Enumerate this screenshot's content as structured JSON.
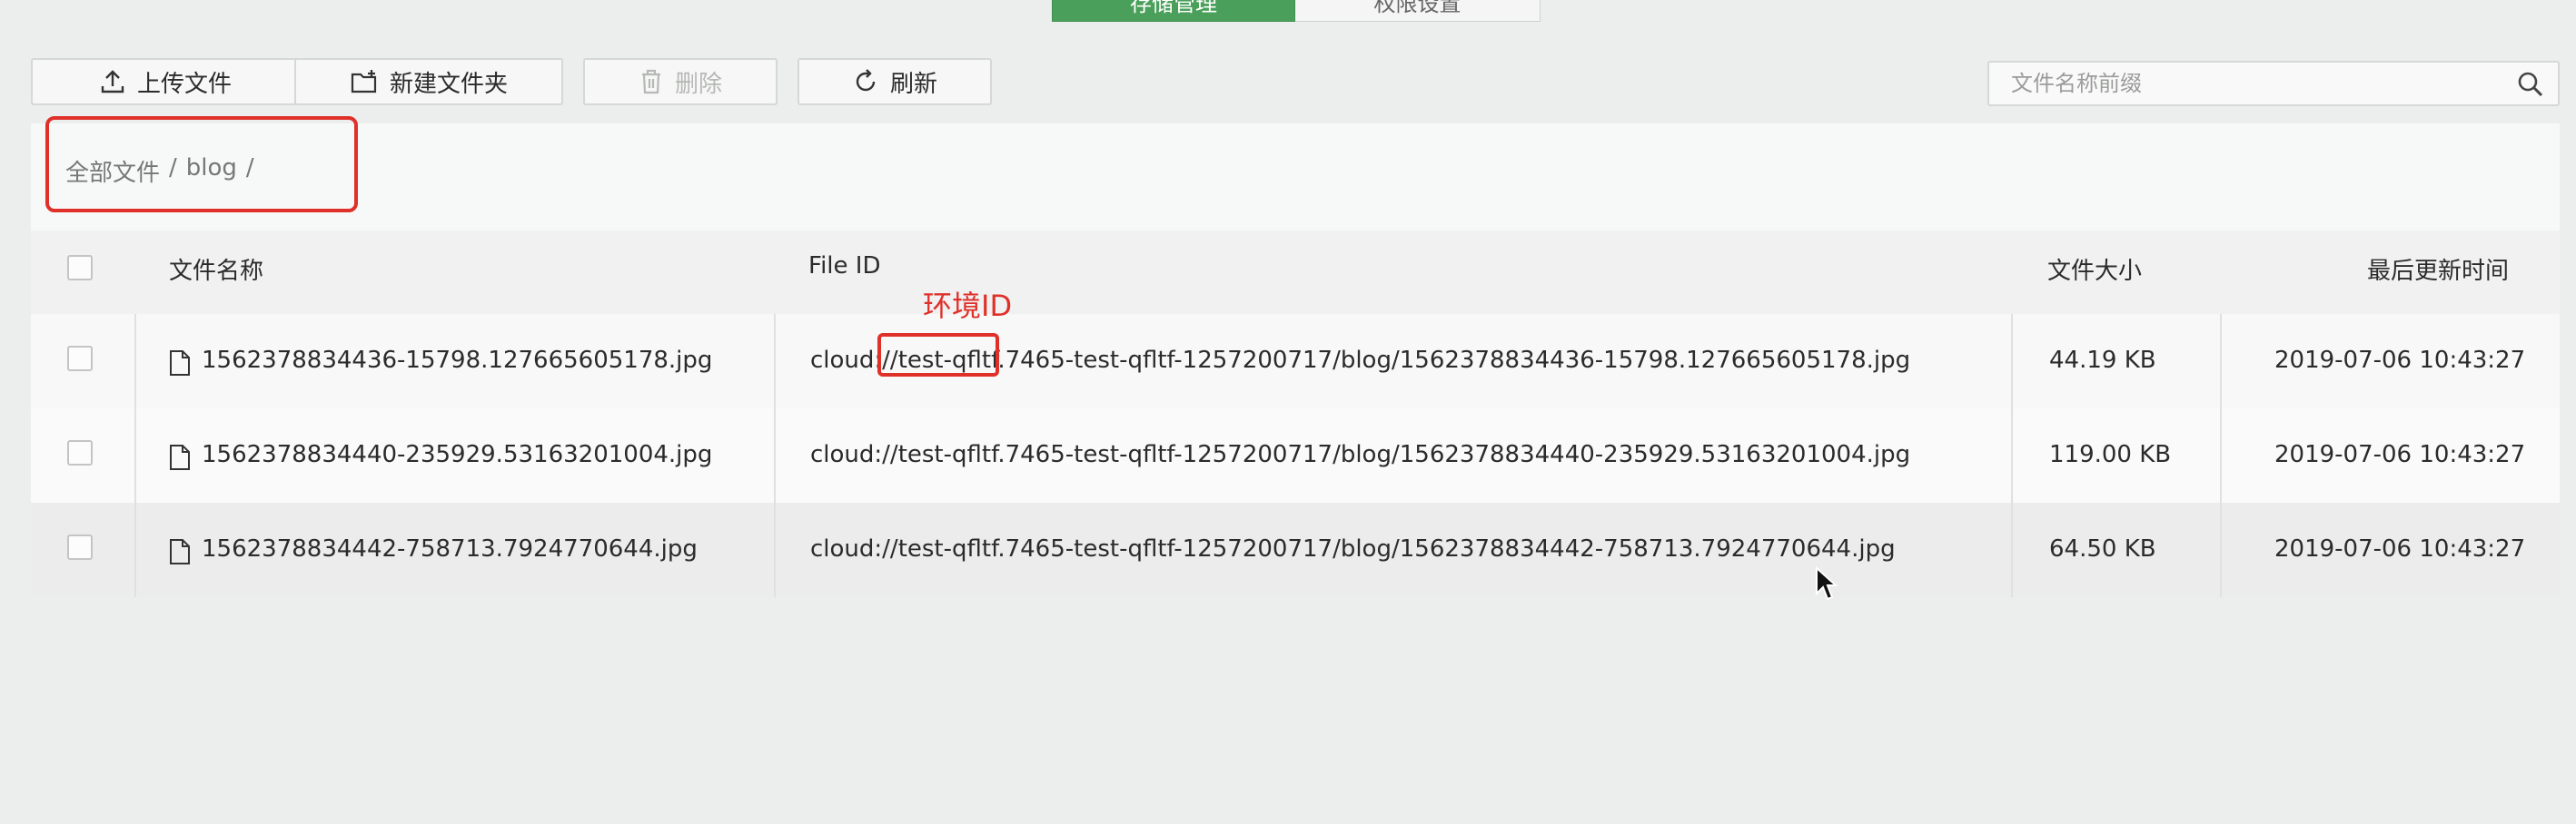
{
  "tabs": [
    {
      "label": "存储管理",
      "active": true
    },
    {
      "label": "权限设置",
      "active": false
    }
  ],
  "toolbar": {
    "upload_label": "上传文件",
    "new_folder_label": "新建文件夹",
    "delete_label": "删除",
    "refresh_label": "刷新"
  },
  "search": {
    "placeholder": "文件名称前缀",
    "value": ""
  },
  "breadcrumb": {
    "root": "全部文件",
    "sep": "/",
    "folder": "blog",
    "trail_sep": "/"
  },
  "annotation": {
    "label": "环境ID"
  },
  "table": {
    "headers": {
      "name": "文件名称",
      "file_id": "File ID",
      "size": "文件大小",
      "updated": "最后更新时间"
    },
    "rows": [
      {
        "name": "1562378834436-15798.127665605178.jpg",
        "file_id": "cloud://test-qfltf.7465-test-qfltf-1257200717/blog/1562378834436-15798.127665605178.jpg",
        "size": "44.19 KB",
        "updated": "2019-07-06 10:43:27"
      },
      {
        "name": "1562378834440-235929.53163201004.jpg",
        "file_id": "cloud://test-qfltf.7465-test-qfltf-1257200717/blog/1562378834440-235929.53163201004.jpg",
        "size": "119.00 KB",
        "updated": "2019-07-06 10:43:27"
      },
      {
        "name": "1562378834442-758713.7924770644.jpg",
        "file_id": "cloud://test-qfltf.7465-test-qfltf-1257200717/blog/1562378834442-758713.7924770644.jpg",
        "size": "64.50 KB",
        "updated": "2019-07-06 10:43:27"
      }
    ]
  },
  "colors": {
    "accent": "#4aa05a",
    "annotation": "#e0302a"
  }
}
